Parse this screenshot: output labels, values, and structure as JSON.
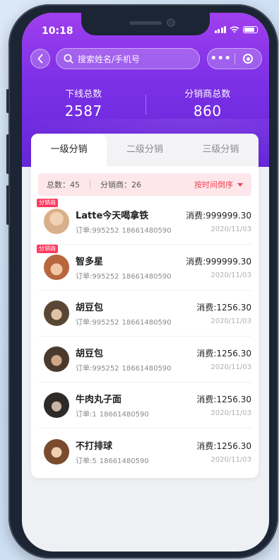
{
  "status_bar": {
    "time": "10:18"
  },
  "search": {
    "placeholder": "搜索姓名/手机号"
  },
  "capsule": {
    "more": "•••"
  },
  "stats": {
    "downline_label": "下线总数",
    "downline_value": "2587",
    "distributor_label": "分销商总数",
    "distributor_value": "860"
  },
  "tabs": [
    {
      "label": "一级分销",
      "active": true
    },
    {
      "label": "二级分销",
      "active": false
    },
    {
      "label": "三级分销",
      "active": false
    }
  ],
  "summary": {
    "total": "总数：45",
    "distributors": "分销商：26",
    "sort": "按时间倒序"
  },
  "rows": [
    {
      "tag": "分销商",
      "name": "Latte今天喝拿铁",
      "order": "订单:995252",
      "phone": "18661480590",
      "amount": "消费:999999.30",
      "date": "2020/11/03",
      "avatar_color": "#d8b08a"
    },
    {
      "tag": "分销商",
      "name": "智多星",
      "order": "订单:995252",
      "phone": "18661480590",
      "amount": "消费:999999.30",
      "date": "2020/11/03",
      "avatar_color": "#b8663e"
    },
    {
      "tag": "",
      "name": "胡豆包",
      "order": "订单:995252",
      "phone": "18661480590",
      "amount": "消费:1256.30",
      "date": "2020/11/03",
      "avatar_color": "#5a4634"
    },
    {
      "tag": "",
      "name": "胡豆包",
      "order": "订单:995252",
      "phone": "18661480590",
      "amount": "消费:1256.30",
      "date": "2020/11/03",
      "avatar_color": "#4a3a2e"
    },
    {
      "tag": "",
      "name": "牛肉丸子面",
      "order": "订单:1",
      "phone": "18661480590",
      "amount": "消费:1256.30",
      "date": "2020/11/03",
      "avatar_color": "#2e2a28"
    },
    {
      "tag": "",
      "name": "不打排球",
      "order": "订单:5",
      "phone": "18661480590",
      "amount": "消费:1256.30",
      "date": "2020/11/03",
      "avatar_color": "#7a4b2e"
    }
  ],
  "colors": {
    "header_top": "#a03fee",
    "header_bottom": "#6527d8",
    "accent": "#ee4455",
    "tag": "#ff3b5f"
  }
}
